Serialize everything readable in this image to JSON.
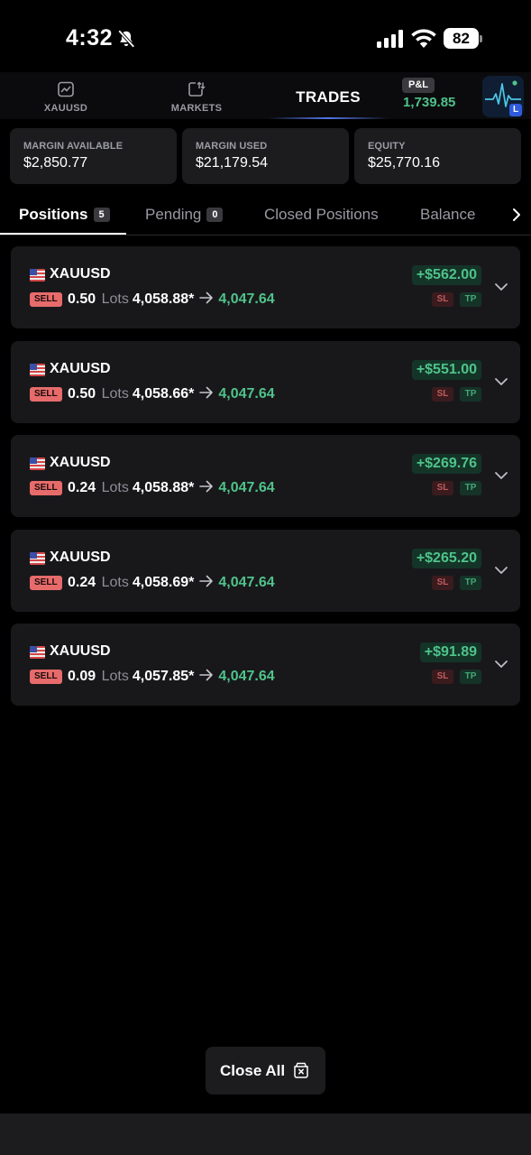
{
  "status_bar": {
    "time": "4:32",
    "battery": "82",
    "icons": [
      "bell-slash-icon",
      "cellular-signal-icon",
      "wifi-icon",
      "battery-icon"
    ]
  },
  "nav": {
    "xauusd_label": "XAUUSD",
    "markets_label": "MARKETS",
    "trades_label": "TRADES",
    "pnl_badge": "P&L",
    "pnl_value": "1,739.85",
    "avatar_badge": "L"
  },
  "summary": {
    "margin_available": {
      "label": "MARGIN AVAILABLE",
      "value": "$2,850.77"
    },
    "margin_used": {
      "label": "MARGIN USED",
      "value": "$21,179.54"
    },
    "equity": {
      "label": "EQUITY",
      "value": "$25,770.16"
    }
  },
  "tabs": {
    "positions": {
      "label": "Positions",
      "count": "5"
    },
    "pending": {
      "label": "Pending",
      "count": "0"
    },
    "closed": {
      "label": "Closed Positions"
    },
    "balance": {
      "label": "Balance"
    }
  },
  "positions": [
    {
      "symbol": "XAUUSD",
      "side": "SELL",
      "qty": "0.50",
      "lots": "Lots",
      "open": "4,058.88*",
      "current": "4,047.64",
      "profit": "+$562.00",
      "sl": "SL",
      "tp": "TP"
    },
    {
      "symbol": "XAUUSD",
      "side": "SELL",
      "qty": "0.50",
      "lots": "Lots",
      "open": "4,058.66*",
      "current": "4,047.64",
      "profit": "+$551.00",
      "sl": "SL",
      "tp": "TP"
    },
    {
      "symbol": "XAUUSD",
      "side": "SELL",
      "qty": "0.24",
      "lots": "Lots",
      "open": "4,058.88*",
      "current": "4,047.64",
      "profit": "+$269.76",
      "sl": "SL",
      "tp": "TP"
    },
    {
      "symbol": "XAUUSD",
      "side": "SELL",
      "qty": "0.24",
      "lots": "Lots",
      "open": "4,058.69*",
      "current": "4,047.64",
      "profit": "+$265.20",
      "sl": "SL",
      "tp": "TP"
    },
    {
      "symbol": "XAUUSD",
      "side": "SELL",
      "qty": "0.09",
      "lots": "Lots",
      "open": "4,057.85*",
      "current": "4,047.64",
      "profit": "+$91.89",
      "sl": "SL",
      "tp": "TP"
    }
  ],
  "footer": {
    "close_all_label": "Close All"
  },
  "colors": {
    "background": "#000000",
    "card": "#1c1c1f",
    "profit_green": "#4fc38a",
    "sell_red": "#e76b6b",
    "accent_blue": "#2f5bdc"
  }
}
